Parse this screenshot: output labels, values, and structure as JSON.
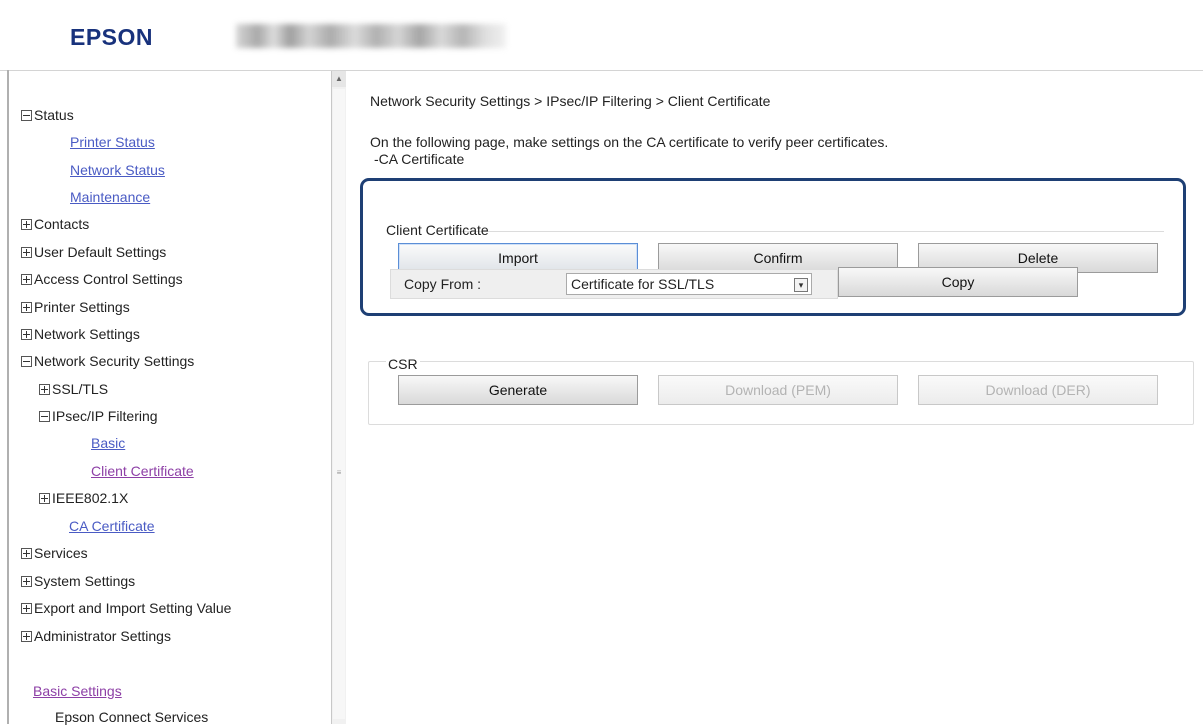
{
  "header": {
    "logo_text": "EPSON",
    "colors": {
      "logo": "#18327c",
      "header_bg": "#ffffff"
    }
  },
  "sidebar": {
    "items": [
      {
        "label": "Status",
        "toggle": "minus",
        "type": "heading"
      },
      {
        "label": "Printer Status",
        "type": "link"
      },
      {
        "label": "Network Status",
        "type": "link"
      },
      {
        "label": "Maintenance",
        "type": "link"
      },
      {
        "label": "Contacts",
        "toggle": "plus",
        "type": "heading"
      },
      {
        "label": "User Default Settings",
        "toggle": "plus",
        "type": "heading"
      },
      {
        "label": "Access Control Settings",
        "toggle": "plus",
        "type": "heading"
      },
      {
        "label": "Printer Settings",
        "toggle": "plus",
        "type": "heading"
      },
      {
        "label": "Network Settings",
        "toggle": "plus",
        "type": "heading"
      },
      {
        "label": "Network Security Settings",
        "toggle": "minus",
        "type": "heading"
      },
      {
        "label": "SSL/TLS",
        "toggle": "plus",
        "type": "heading"
      },
      {
        "label": "IPsec/IP Filtering",
        "toggle": "minus",
        "type": "heading"
      },
      {
        "label": "Basic",
        "type": "link"
      },
      {
        "label": "Client Certificate",
        "type": "link",
        "visited": true
      },
      {
        "label": "IEEE802.1X",
        "toggle": "plus",
        "type": "heading"
      },
      {
        "label": "CA Certificate",
        "type": "link"
      },
      {
        "label": "Services",
        "toggle": "plus",
        "type": "heading"
      },
      {
        "label": "System Settings",
        "toggle": "plus",
        "type": "heading"
      },
      {
        "label": "Export and Import Setting Value",
        "toggle": "plus",
        "type": "heading"
      },
      {
        "label": "Administrator Settings",
        "toggle": "plus",
        "type": "heading"
      },
      {
        "label": "Basic Settings",
        "type": "link",
        "visited": true
      },
      {
        "label": "Epson Connect Services",
        "type": "text"
      }
    ],
    "colors": {
      "link": "#4a5bc4",
      "visited": "#8d3fa6"
    }
  },
  "main": {
    "breadcrumb": "Network Security Settings > IPsec/IP Filtering > Client Certificate",
    "description_line1": "On the following page, make settings on the CA certificate to verify peer certificates.",
    "description_line2": "-CA Certificate",
    "client_certificate": {
      "legend": "Client Certificate",
      "import_label": "Import",
      "confirm_label": "Confirm",
      "delete_label": "Delete",
      "copy_from_label": "Copy From :",
      "copy_from_value": "Certificate for SSL/TLS",
      "copy_label": "Copy",
      "highlight_color": "#1e3f74"
    },
    "csr": {
      "legend": "CSR",
      "generate_label": "Generate",
      "download_pem_label": "Download (PEM)",
      "download_der_label": "Download (DER)",
      "download_enabled": false
    }
  }
}
